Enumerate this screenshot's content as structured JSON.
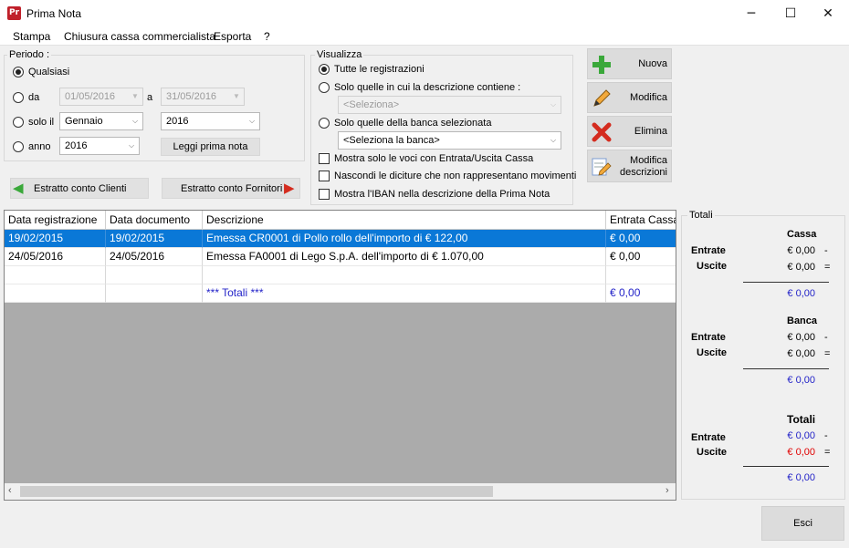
{
  "window": {
    "title": "Prima Nota",
    "icon": "app-logo-icon",
    "minimize": "─",
    "maximize": "☐",
    "close": "✕"
  },
  "menu": [
    "Stampa",
    "Chiusura cassa commercialista",
    "Esporta",
    "?"
  ],
  "periodo": {
    "label": "Periodo :",
    "qualsiasi": "Qualsiasi",
    "da": "da",
    "da_value": "01/05/2016",
    "a": "a",
    "a_value": "31/05/2016",
    "solo_il": "solo il",
    "mese": "Gennaio",
    "anno_mese": "2016",
    "anno": "anno",
    "anno_value": "2016",
    "leggi": "Leggi prima nota"
  },
  "visualizza": {
    "label": "Visualizza",
    "tutte": "Tutte le registrazioni",
    "descrizione_contiene": "Solo quelle in cui la descrizione contiene :",
    "seleziona": "<Seleziona>",
    "banca_selezionata": "Solo quelle della banca selezionata",
    "seleziona_banca": "<Seleziona la banca>",
    "cb_cassa": "Mostra solo le voci con Entrata/Uscita Cassa",
    "cb_diciture": "Nascondi le diciture che non rappresentano movimenti",
    "cb_iban": "Mostra l'IBAN nella descrizione della Prima Nota"
  },
  "buttons": {
    "nuova": "Nuova",
    "modifica": "Modifica",
    "elimina": "Elimina",
    "modifica_descr_1": "Modifica",
    "modifica_descr_2": "descrizioni",
    "estratto_clienti": "Estratto conto Clienti",
    "estratto_fornitori": "Estratto conto Fornitori",
    "esci": "Esci"
  },
  "colors": {
    "selection": "#0a78d7",
    "nuova_icon": "#3aa83a",
    "elimina_icon": "#d42b1e",
    "totali_blue": "#2323c8",
    "uscite_red": "#e00000"
  },
  "grid": {
    "headers": [
      "Data registrazione",
      "Data documento",
      "Descrizione",
      "Entrata Cassa"
    ],
    "rows": [
      [
        "19/02/2015",
        "19/02/2015",
        "Emessa CR0001 di Pollo rollo dell'importo di € 122,00",
        "€ 0,00"
      ],
      [
        "24/05/2016",
        "24/05/2016",
        "Emessa FA0001 di Lego S.p.A. dell'importo di € 1.070,00",
        "€ 0,00"
      ],
      [
        "",
        "",
        "",
        ""
      ],
      [
        "",
        "",
        "*** Totali ***",
        "€ 0,00"
      ]
    ]
  },
  "totali": {
    "label": "Totali",
    "cassa": {
      "title": "Cassa",
      "entrate_label": "Entrate",
      "entrate": "€ 0,00",
      "uscite_label": "Uscite",
      "uscite": "€ 0,00",
      "saldo": "€ 0,00"
    },
    "banca": {
      "title": "Banca",
      "entrate_label": "Entrate",
      "entrate": "€ 0,00",
      "uscite_label": "Uscite",
      "uscite": "€ 0,00",
      "saldo": "€ 0,00"
    },
    "totali": {
      "title": "Totali",
      "entrate_label": "Entrate",
      "entrate": "€ 0,00",
      "uscite_label": "Uscite",
      "uscite": "€ 0,00",
      "saldo": "€ 0,00"
    },
    "minus": "-",
    "equals": "="
  }
}
